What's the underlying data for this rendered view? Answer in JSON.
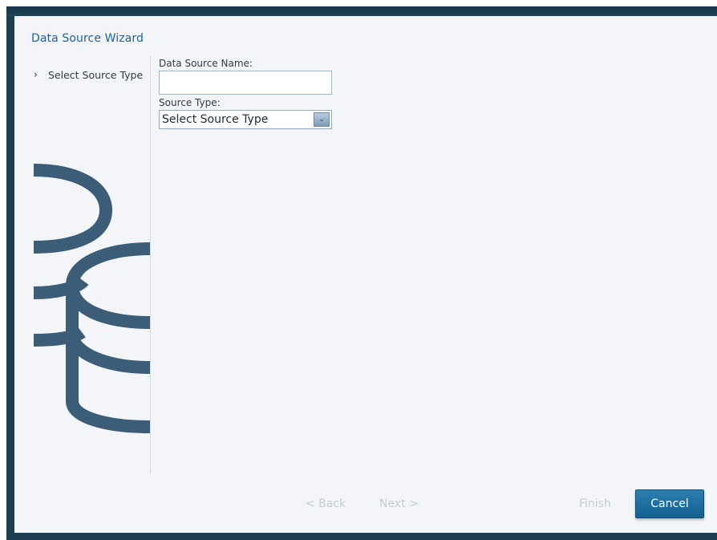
{
  "wizard": {
    "title": "Data Source Wizard"
  },
  "steps": [
    {
      "label": "Select Source Type",
      "icon": "chevron-right-icon"
    }
  ],
  "form": {
    "name_label": "Data Source Name:",
    "name_value": "",
    "name_placeholder": "",
    "type_label": "Source Type:",
    "type_selected": "Select Source Type",
    "type_dropdown_icon": "chevron-down-icon"
  },
  "footer": {
    "back_label": "< Back",
    "next_label": "Next >",
    "finish_label": "Finish",
    "cancel_label": "Cancel"
  },
  "colors": {
    "frame": "#1c3d52",
    "dialog_background": "#f4f5f8",
    "title": "#1f5f9e",
    "art": "#3c5d77",
    "cancel_button": "#1a6d9e",
    "disabled_text": "#c5ccd3"
  }
}
